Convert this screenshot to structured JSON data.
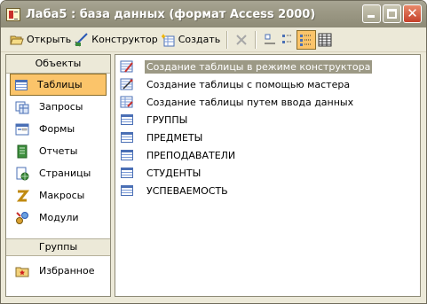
{
  "window": {
    "title": "Лаба5 : база данных (формат Access 2000)"
  },
  "toolbar": {
    "open_label": "Открыть",
    "design_label": "Конструктор",
    "create_label": "Создать"
  },
  "sidebar": {
    "header": "Объекты",
    "items": [
      {
        "label": "Таблицы",
        "icon": "table-icon"
      },
      {
        "label": "Запросы",
        "icon": "query-icon"
      },
      {
        "label": "Формы",
        "icon": "form-icon"
      },
      {
        "label": "Отчеты",
        "icon": "report-icon"
      },
      {
        "label": "Страницы",
        "icon": "page-icon"
      },
      {
        "label": "Макросы",
        "icon": "macro-icon"
      },
      {
        "label": "Модули",
        "icon": "module-icon"
      }
    ],
    "groups_header": "Группы",
    "favorites_label": "Избранное"
  },
  "list": {
    "items": [
      {
        "label": "Создание таблицы в режиме конструктора",
        "icon": "design-wizard-icon",
        "selected": true
      },
      {
        "label": "Создание таблицы с помощью мастера",
        "icon": "wizard-icon"
      },
      {
        "label": "Создание таблицы путем ввода данных",
        "icon": "datasheet-wizard-icon"
      },
      {
        "label": "ГРУППЫ",
        "icon": "table-icon"
      },
      {
        "label": "ПРЕДМЕТЫ",
        "icon": "table-icon"
      },
      {
        "label": "ПРЕПОДАВАТЕЛИ",
        "icon": "table-icon"
      },
      {
        "label": "СТУДЕНТЫ",
        "icon": "table-icon"
      },
      {
        "label": "УСПЕВАЕМОСТЬ",
        "icon": "table-icon"
      }
    ]
  },
  "colors": {
    "active_item_bg": "#fbc46a",
    "titlebar": "#9c9985",
    "selection": "#9c9985"
  }
}
